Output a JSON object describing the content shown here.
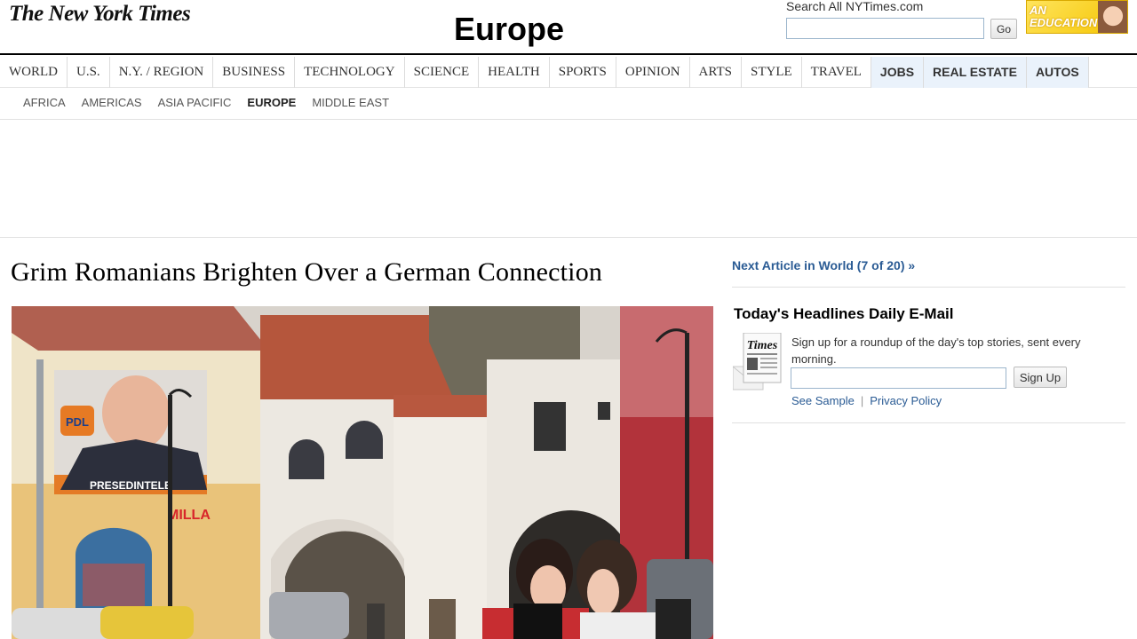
{
  "masthead": {
    "logo_text": "The New York Times",
    "section_title": "Europe",
    "search_label": "Search All NYTimes.com",
    "search_value": "",
    "search_button": "Go",
    "ad_text": "AN EDUCATION"
  },
  "nav": {
    "items": [
      {
        "label": "WORLD",
        "special": false
      },
      {
        "label": "U.S.",
        "special": false
      },
      {
        "label": "N.Y. / REGION",
        "special": false
      },
      {
        "label": "BUSINESS",
        "special": false
      },
      {
        "label": "TECHNOLOGY",
        "special": false
      },
      {
        "label": "SCIENCE",
        "special": false
      },
      {
        "label": "HEALTH",
        "special": false
      },
      {
        "label": "SPORTS",
        "special": false
      },
      {
        "label": "OPINION",
        "special": false
      },
      {
        "label": "ARTS",
        "special": false
      },
      {
        "label": "STYLE",
        "special": false
      },
      {
        "label": "TRAVEL",
        "special": false
      },
      {
        "label": "JOBS",
        "special": true
      },
      {
        "label": "REAL ESTATE",
        "special": true
      },
      {
        "label": "AUTOS",
        "special": true
      }
    ]
  },
  "subnav": {
    "items": [
      "AFRICA",
      "AMERICAS",
      "ASIA PACIFIC",
      "EUROPE",
      "MIDDLE EAST"
    ],
    "active": "EUROPE"
  },
  "article": {
    "headline": "Grim Romanians Brighten Over a German Connection",
    "photo_poster_text": "PDL",
    "photo_banner_text": "PRESEDINTELE",
    "photo_shop_sign": "MILLA"
  },
  "sidebar": {
    "next_article": "Next Article in World (7 of 20) »",
    "email_title": "Today's Headlines Daily E-Mail",
    "email_icon_text": "Times",
    "email_description": "Sign up for a roundup of the day's top stories, sent every morning.",
    "email_value": "",
    "signup_button": "Sign Up",
    "see_sample": "See Sample",
    "privacy_policy": "Privacy Policy",
    "link_separator": "|"
  }
}
